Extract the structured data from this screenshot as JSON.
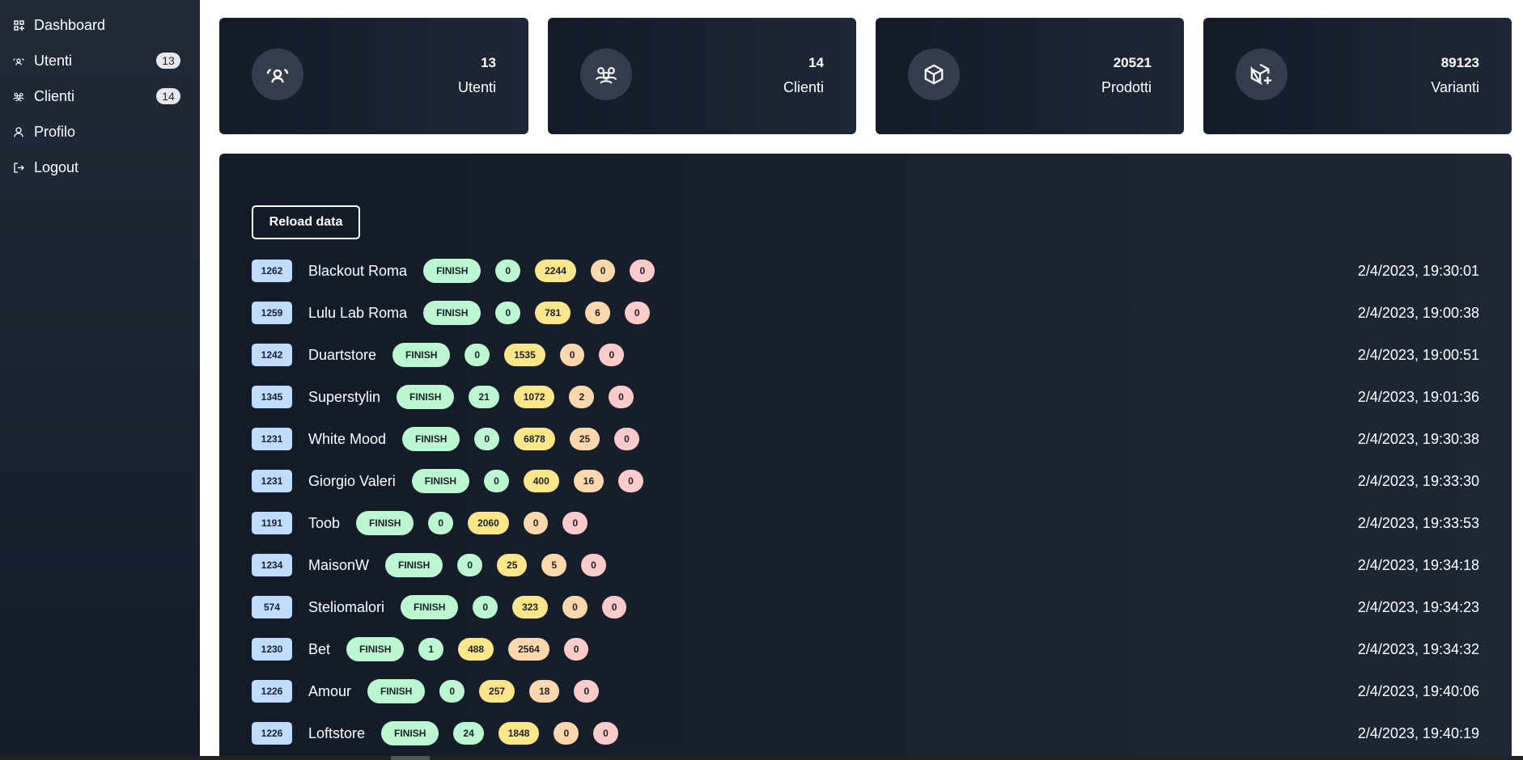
{
  "sidebar": {
    "items": [
      {
        "label": "Dashboard",
        "icon": "dashboard-icon"
      },
      {
        "label": "Utenti",
        "icon": "users-icon",
        "badge": "13"
      },
      {
        "label": "Clienti",
        "icon": "clients-icon",
        "badge": "14"
      },
      {
        "label": "Profilo",
        "icon": "profile-icon"
      },
      {
        "label": "Logout",
        "icon": "logout-icon"
      }
    ]
  },
  "cards": [
    {
      "value": "13",
      "label": "Utenti",
      "icon": "users-icon"
    },
    {
      "value": "14",
      "label": "Clienti",
      "icon": "clients-icon"
    },
    {
      "value": "20521",
      "label": "Prodotti",
      "icon": "box-icon"
    },
    {
      "value": "89123",
      "label": "Varianti",
      "icon": "box-plus-icon"
    }
  ],
  "reload_label": "Reload data",
  "rows": [
    {
      "id": "1262",
      "name": "Blackout Roma",
      "status": "FINISH",
      "a": "0",
      "b": "2244",
      "c": "0",
      "d": "0",
      "time": "2/4/2023, 19:30:01"
    },
    {
      "id": "1259",
      "name": "Lulu Lab Roma",
      "status": "FINISH",
      "a": "0",
      "b": "781",
      "c": "6",
      "d": "0",
      "time": "2/4/2023, 19:00:38"
    },
    {
      "id": "1242",
      "name": "Duartstore",
      "status": "FINISH",
      "a": "0",
      "b": "1535",
      "c": "0",
      "d": "0",
      "time": "2/4/2023, 19:00:51"
    },
    {
      "id": "1345",
      "name": "Superstylin",
      "status": "FINISH",
      "a": "21",
      "b": "1072",
      "c": "2",
      "d": "0",
      "time": "2/4/2023, 19:01:36"
    },
    {
      "id": "1231",
      "name": "White Mood",
      "status": "FINISH",
      "a": "0",
      "b": "6878",
      "c": "25",
      "d": "0",
      "time": "2/4/2023, 19:30:38"
    },
    {
      "id": "1231",
      "name": "Giorgio Valeri",
      "status": "FINISH",
      "a": "0",
      "b": "400",
      "c": "16",
      "d": "0",
      "time": "2/4/2023, 19:33:30"
    },
    {
      "id": "1191",
      "name": "Toob",
      "status": "FINISH",
      "a": "0",
      "b": "2060",
      "c": "0",
      "d": "0",
      "time": "2/4/2023, 19:33:53"
    },
    {
      "id": "1234",
      "name": "MaisonW",
      "status": "FINISH",
      "a": "0",
      "b": "25",
      "c": "5",
      "d": "0",
      "time": "2/4/2023, 19:34:18"
    },
    {
      "id": "574",
      "name": "Steliomalori",
      "status": "FINISH",
      "a": "0",
      "b": "323",
      "c": "0",
      "d": "0",
      "time": "2/4/2023, 19:34:23"
    },
    {
      "id": "1230",
      "name": "Bet",
      "status": "FINISH",
      "a": "1",
      "b": "488",
      "c": "2564",
      "d": "0",
      "time": "2/4/2023, 19:34:32"
    },
    {
      "id": "1226",
      "name": "Amour",
      "status": "FINISH",
      "a": "0",
      "b": "257",
      "c": "18",
      "d": "0",
      "time": "2/4/2023, 19:40:06"
    },
    {
      "id": "1226",
      "name": "Loftstore",
      "status": "FINISH",
      "a": "24",
      "b": "1848",
      "c": "0",
      "d": "0",
      "time": "2/4/2023, 19:40:19"
    }
  ]
}
